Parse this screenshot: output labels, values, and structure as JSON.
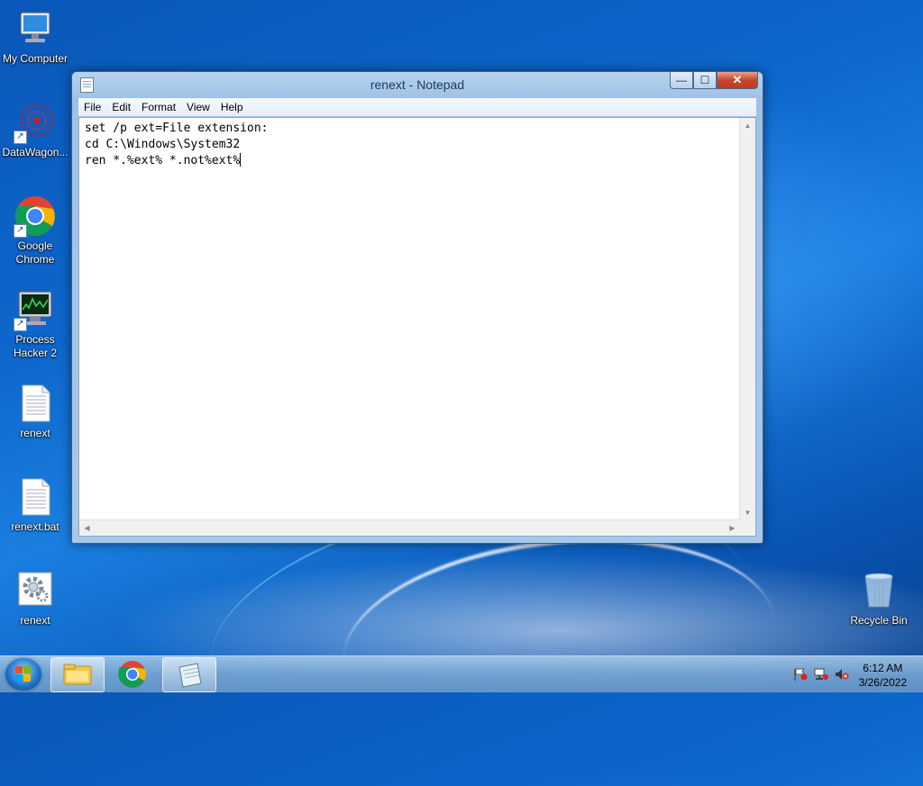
{
  "desktop": {
    "icons": [
      {
        "label": "My Computer"
      },
      {
        "label": "DataWagon..."
      },
      {
        "label": "Google Chrome"
      },
      {
        "label": "Process Hacker 2"
      },
      {
        "label": "renext"
      },
      {
        "label": "renext.bat"
      },
      {
        "label": "renext"
      },
      {
        "label": "Recycle Bin"
      }
    ]
  },
  "window": {
    "title": "renext - Notepad",
    "controls": {
      "minimize": "—",
      "maximize": "☐",
      "close": "✕"
    },
    "menu": [
      "File",
      "Edit",
      "Format",
      "View",
      "Help"
    ],
    "content_lines": [
      "set /p ext=File extension:",
      "cd C:\\Windows\\System32",
      "ren *.%ext% *.not%ext%"
    ]
  },
  "taskbar": {
    "time": "6:12 AM",
    "date": "3/26/2022"
  },
  "colors": {
    "accent": "#0d67cc",
    "close_button": "#c7452a"
  }
}
